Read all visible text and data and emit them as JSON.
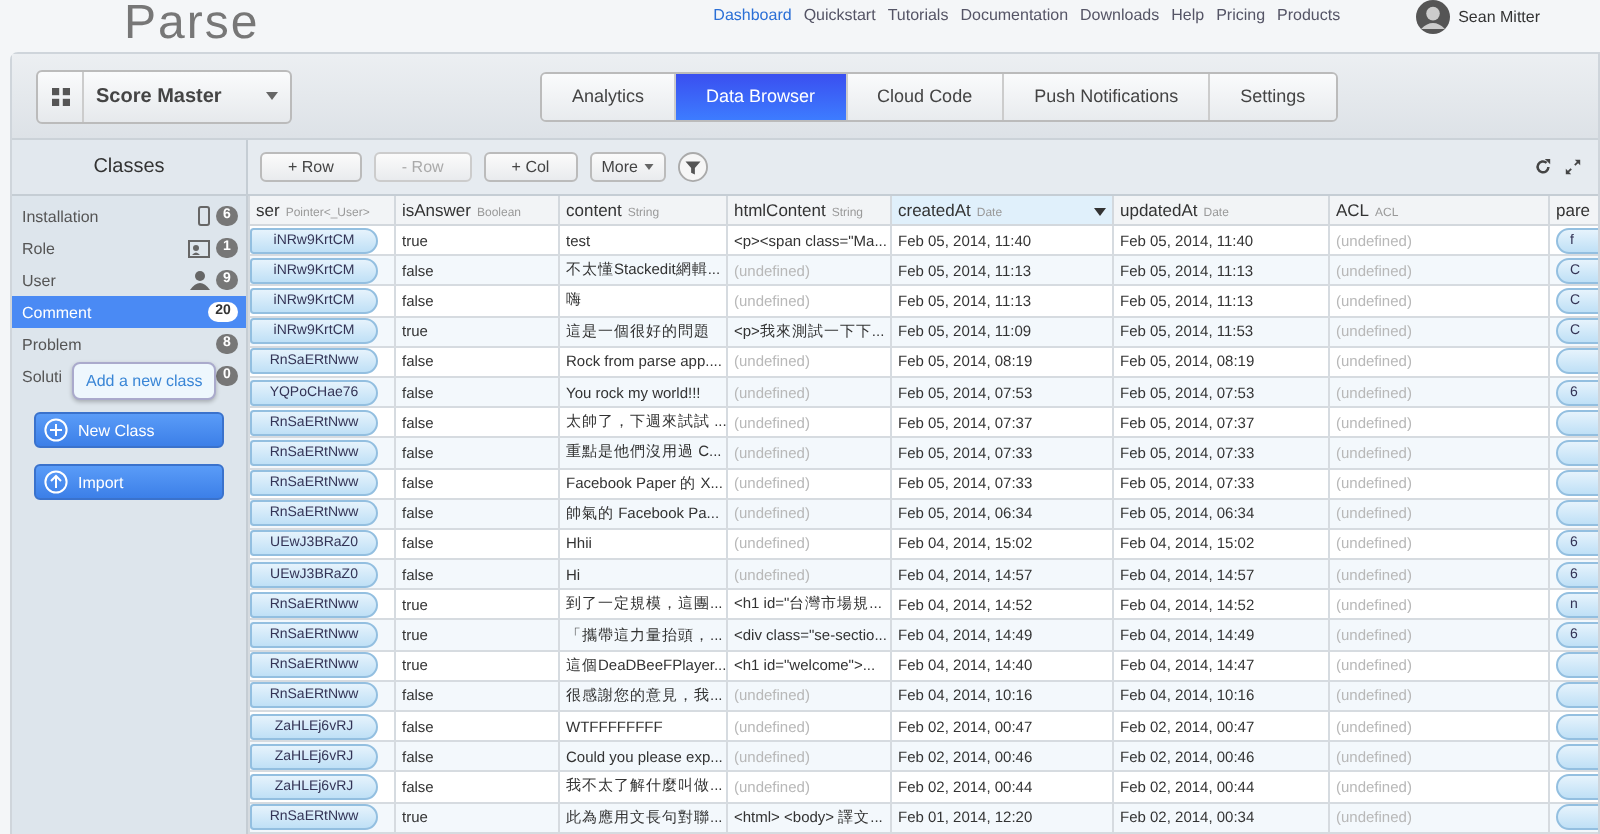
{
  "logo": "Parse",
  "nav": [
    {
      "label": "Dashboard",
      "selected": true
    },
    {
      "label": "Quickstart",
      "selected": false
    },
    {
      "label": "Tutorials",
      "selected": false
    },
    {
      "label": "Documentation",
      "selected": false
    },
    {
      "label": "Downloads",
      "selected": false
    },
    {
      "label": "Help",
      "selected": false
    },
    {
      "label": "Pricing",
      "selected": false
    },
    {
      "label": "Products",
      "selected": false
    }
  ],
  "user": {
    "name": "Sean Mitter"
  },
  "app_selector": {
    "value": "Score Master"
  },
  "tabs": [
    {
      "label": "Analytics",
      "selected": false
    },
    {
      "label": "Data Browser",
      "selected": true
    },
    {
      "label": "Cloud Code",
      "selected": false
    },
    {
      "label": "Push Notifications",
      "selected": false
    },
    {
      "label": "Settings",
      "selected": false
    }
  ],
  "sidebar": {
    "title": "Classes",
    "items": [
      {
        "label": "Installation",
        "count": "6",
        "selected": false
      },
      {
        "label": "Role",
        "count": "1",
        "selected": false
      },
      {
        "label": "User",
        "count": "9",
        "selected": false
      },
      {
        "label": "Comment",
        "count": "20",
        "selected": true
      },
      {
        "label": "Problem",
        "count": "8",
        "selected": false
      },
      {
        "label": "Soluti",
        "count": "0",
        "selected": false
      }
    ],
    "tooltip": "Add a new class",
    "buttons": [
      {
        "label": "New Class"
      },
      {
        "label": "Import"
      }
    ]
  },
  "toolbar": {
    "buttons": [
      {
        "label": "+ Row",
        "disabled": false
      },
      {
        "label": "- Row",
        "disabled": true
      },
      {
        "label": "+ Col",
        "disabled": false
      }
    ],
    "more": "More"
  },
  "table": {
    "columns": [
      {
        "name": "ser",
        "type": "Pointer<_User>",
        "sorted": false
      },
      {
        "name": "isAnswer",
        "type": "Boolean",
        "sorted": false
      },
      {
        "name": "content",
        "type": "String",
        "sorted": false
      },
      {
        "name": "htmlContent",
        "type": "String",
        "sorted": false
      },
      {
        "name": "createdAt",
        "type": "Date",
        "sorted": true
      },
      {
        "name": "updatedAt",
        "type": "Date",
        "sorted": false
      },
      {
        "name": "ACL",
        "type": "ACL",
        "sorted": false
      },
      {
        "name": "pare",
        "sorted": false
      }
    ],
    "rows": [
      {
        "user": "iNRw9KrtCM",
        "is_answer": "true",
        "content": "test",
        "html": "<p><span class=\"Ma...",
        "html_missing": false,
        "created": "Feb 05, 2014, 11:40",
        "updated": "Feb 05, 2014, 11:40",
        "acl": "(undefined)",
        "parent": "f"
      },
      {
        "user": "iNRw9KrtCM",
        "is_answer": "false",
        "content": "不太懂Stackedit網輯...",
        "html": "(undefined)",
        "html_missing": true,
        "created": "Feb 05, 2014, 11:13",
        "updated": "Feb 05, 2014, 11:13",
        "acl": "(undefined)",
        "parent": "C"
      },
      {
        "user": "iNRw9KrtCM",
        "is_answer": "false",
        "content": "嗨",
        "html": "(undefined)",
        "html_missing": true,
        "created": "Feb 05, 2014, 11:13",
        "updated": "Feb 05, 2014, 11:13",
        "acl": "(undefined)",
        "parent": "C"
      },
      {
        "user": "iNRw9KrtCM",
        "is_answer": "true",
        "content": "這是一個很好的問題",
        "html": "<p>我來測試一下下...",
        "html_missing": false,
        "created": "Feb 05, 2014, 11:09",
        "updated": "Feb 05, 2014, 11:53",
        "acl": "(undefined)",
        "parent": "C"
      },
      {
        "user": "RnSaERtNww",
        "is_answer": "false",
        "content": "Rock from parse app....",
        "html": "(undefined)",
        "html_missing": true,
        "created": "Feb 05, 2014, 08:19",
        "updated": "Feb 05, 2014, 08:19",
        "acl": "(undefined)"
      },
      {
        "user": "YQPoCHae76",
        "is_answer": "false",
        "content": "You rock my world!!!",
        "html": "(undefined)",
        "html_missing": true,
        "created": "Feb 05, 2014, 07:53",
        "updated": "Feb 05, 2014, 07:53",
        "acl": "(undefined)",
        "parent": "6"
      },
      {
        "user": "RnSaERtNww",
        "is_answer": "false",
        "content": "太帥了，下週來試試 ...",
        "html": "(undefined)",
        "html_missing": true,
        "created": "Feb 05, 2014, 07:37",
        "updated": "Feb 05, 2014, 07:37",
        "acl": "(undefined)"
      },
      {
        "user": "RnSaERtNww",
        "is_answer": "false",
        "content": "重點是他們沒用過 C...",
        "html": "(undefined)",
        "html_missing": true,
        "created": "Feb 05, 2014, 07:33",
        "updated": "Feb 05, 2014, 07:33",
        "acl": "(undefined)"
      },
      {
        "user": "RnSaERtNww",
        "is_answer": "false",
        "content": "Facebook Paper 的 X...",
        "html": "(undefined)",
        "html_missing": true,
        "created": "Feb 05, 2014, 07:33",
        "updated": "Feb 05, 2014, 07:33",
        "acl": "(undefined)"
      },
      {
        "user": "RnSaERtNww",
        "is_answer": "false",
        "content": "帥氣的 Facebook Pa...",
        "html": "(undefined)",
        "html_missing": true,
        "created": "Feb 05, 2014, 06:34",
        "updated": "Feb 05, 2014, 06:34",
        "acl": "(undefined)"
      },
      {
        "user": "UEwJ3BRaZ0",
        "is_answer": "false",
        "content": "Hhii",
        "html": "(undefined)",
        "html_missing": true,
        "created": "Feb 04, 2014, 15:02",
        "updated": "Feb 04, 2014, 15:02",
        "acl": "(undefined)",
        "parent": "6"
      },
      {
        "user": "UEwJ3BRaZ0",
        "is_answer": "false",
        "content": "Hi",
        "html": "(undefined)",
        "html_missing": true,
        "created": "Feb 04, 2014, 14:57",
        "updated": "Feb 04, 2014, 14:57",
        "acl": "(undefined)",
        "parent": "6"
      },
      {
        "user": "RnSaERtNww",
        "is_answer": "true",
        "content": "到了一定規模，這團...",
        "html": "<h1 id=\"台灣市場規...",
        "html_missing": false,
        "created": "Feb 04, 2014, 14:52",
        "updated": "Feb 04, 2014, 14:52",
        "acl": "(undefined)",
        "parent": "n"
      },
      {
        "user": "RnSaERtNww",
        "is_answer": "true",
        "content": "「攜帶這力量抬頭，...",
        "html": "<div class=\"se-sectio...",
        "html_missing": false,
        "created": "Feb 04, 2014, 14:49",
        "updated": "Feb 04, 2014, 14:49",
        "acl": "(undefined)",
        "parent": "6"
      },
      {
        "user": "RnSaERtNww",
        "is_answer": "true",
        "content": "這個DeaDBeeFPlayer...",
        "html": "<h1 id=\"welcome\">...",
        "html_missing": false,
        "created": "Feb 04, 2014, 14:40",
        "updated": "Feb 04, 2014, 14:47",
        "acl": "(undefined)"
      },
      {
        "user": "RnSaERtNww",
        "is_answer": "false",
        "content": "很感謝您的意見，我...",
        "html": "(undefined)",
        "html_missing": true,
        "created": "Feb 04, 2014, 10:16",
        "updated": "Feb 04, 2014, 10:16",
        "acl": "(undefined)"
      },
      {
        "user": "ZaHLEj6vRJ",
        "is_answer": "false",
        "content": "WTFFFFFFFF",
        "html": "(undefined)",
        "html_missing": true,
        "created": "Feb 02, 2014, 00:47",
        "updated": "Feb 02, 2014, 00:47",
        "acl": "(undefined)"
      },
      {
        "user": "ZaHLEj6vRJ",
        "is_answer": "false",
        "content": "Could you please exp...",
        "html": "(undefined)",
        "html_missing": true,
        "created": "Feb 02, 2014, 00:46",
        "updated": "Feb 02, 2014, 00:46",
        "acl": "(undefined)"
      },
      {
        "user": "ZaHLEj6vRJ",
        "is_answer": "false",
        "content": "我不太了解什麼叫做...",
        "html": "(undefined)",
        "html_missing": true,
        "created": "Feb 02, 2014, 00:44",
        "updated": "Feb 02, 2014, 00:44",
        "acl": "(undefined)"
      },
      {
        "user": "RnSaERtNww",
        "is_answer": "true",
        "content": "此為應用文長句對聯...",
        "html": "<html> <body> 譯文...",
        "html_missing": false,
        "created": "Feb 01, 2014, 12:20",
        "updated": "Feb 02, 2014, 00:34",
        "acl": "(undefined)"
      }
    ]
  }
}
